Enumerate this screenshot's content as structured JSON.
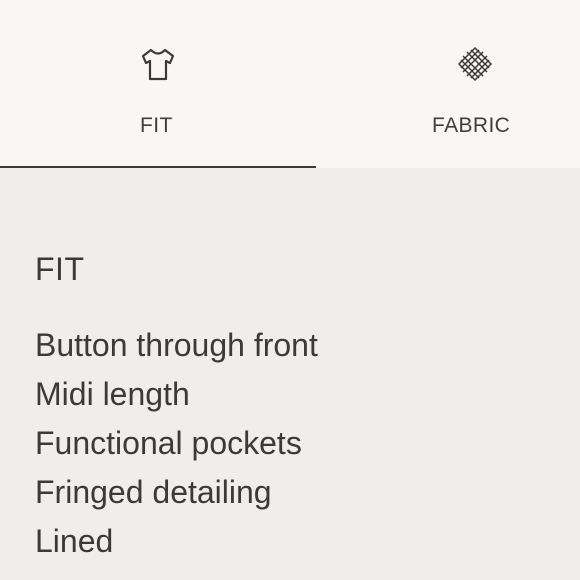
{
  "tabs": [
    {
      "label": "FIT",
      "icon": "t-shirt-icon",
      "selected": true
    },
    {
      "label": "FABRIC",
      "icon": "woven-fabric-icon",
      "selected": false
    }
  ],
  "panel": {
    "title": "FIT",
    "items": [
      "Button through front",
      "Midi length",
      "Functional pockets",
      "Fringed detailing",
      "Lined"
    ]
  },
  "colors": {
    "tab_bar_background": "#f8f7f4",
    "panel_background": "#efeeeb",
    "text": "#3a3a38",
    "active_underline": "#3a3a38"
  }
}
